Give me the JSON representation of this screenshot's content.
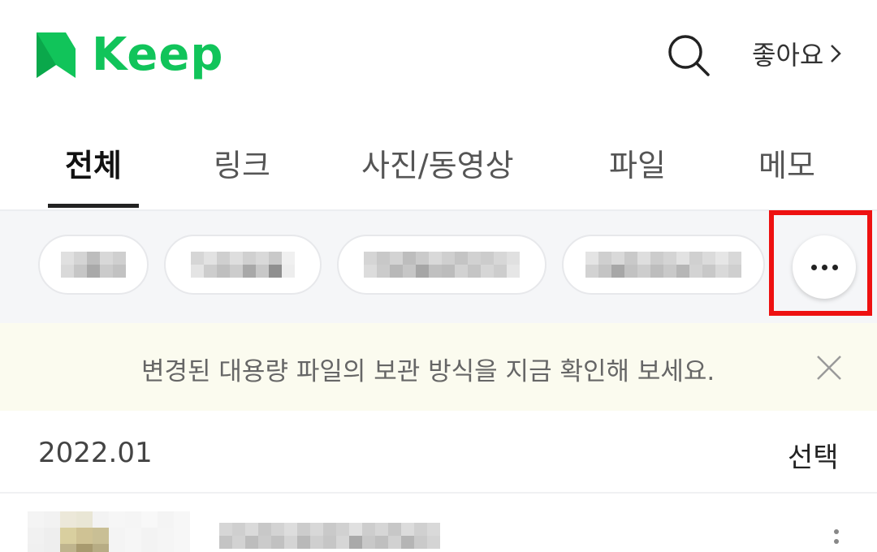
{
  "app": {
    "name": "Keep",
    "brand_color": "#11c45a"
  },
  "header": {
    "search_icon": "search-icon",
    "likes_label": "좋아요"
  },
  "tabs": [
    {
      "label": "전체",
      "active": true
    },
    {
      "label": "링크",
      "active": false
    },
    {
      "label": "사진/동영상",
      "active": false
    },
    {
      "label": "파일",
      "active": false
    },
    {
      "label": "메모",
      "active": false
    }
  ],
  "filters": {
    "more_icon": "ellipsis-icon",
    "highlight_color": "#ee1111"
  },
  "notice": {
    "text": "변경된 대용량 파일의 보관 방식을 지금 확인해 보세요.",
    "close_icon": "close-icon"
  },
  "content": {
    "date_label": "2022.01",
    "select_label": "선택"
  }
}
